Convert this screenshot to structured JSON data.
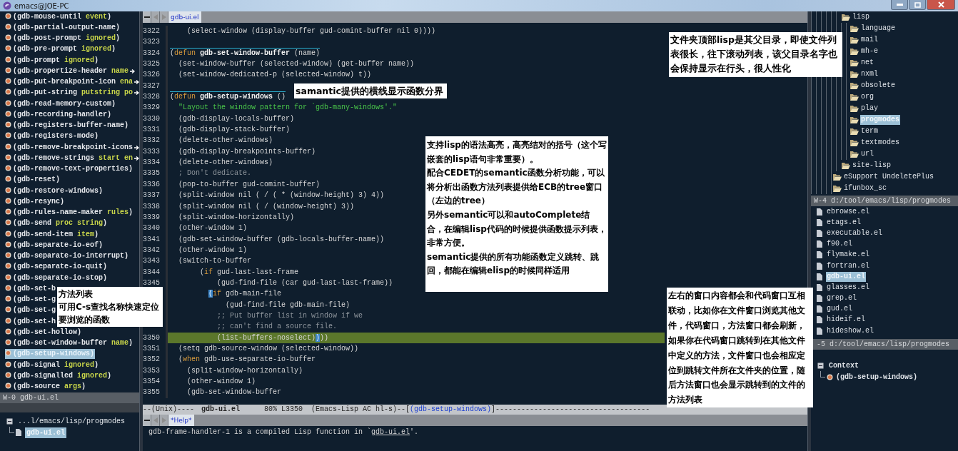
{
  "title_bar": {
    "title": "emacs@JOE-PC"
  },
  "method_list": {
    "items": [
      {
        "name": "(gdb-mouse-until",
        "args": "event",
        "tail": ")",
        "selected": false,
        "truncated": false
      },
      {
        "name": "(gdb-partial-output-name)",
        "selected": false,
        "truncated": false
      },
      {
        "name": "(gdb-post-prompt",
        "args": "ignored",
        "tail": ")",
        "selected": false,
        "truncated": false
      },
      {
        "name": "(gdb-pre-prompt",
        "args": "ignored",
        "tail": ")",
        "selected": false,
        "truncated": false
      },
      {
        "name": "(gdb-prompt",
        "args": "ignored",
        "tail": ")",
        "selected": false,
        "truncated": false
      },
      {
        "name": "(gdb-propertize-header",
        "args": "name",
        "selected": false,
        "truncated": true
      },
      {
        "name": "(gdb-put-breakpoint-icon",
        "args": "ena",
        "selected": false,
        "truncated": true
      },
      {
        "name": "(gdb-put-string",
        "args": "putstring po",
        "selected": false,
        "truncated": true
      },
      {
        "name": "(gdb-read-memory-custom)",
        "selected": false,
        "truncated": false
      },
      {
        "name": "(gdb-recording-handler)",
        "selected": false,
        "truncated": false
      },
      {
        "name": "(gdb-registers-buffer-name)",
        "selected": false,
        "truncated": false
      },
      {
        "name": "(gdb-registers-mode)",
        "selected": false,
        "truncated": false
      },
      {
        "name": "(gdb-remove-breakpoint-icons",
        "selected": false,
        "truncated": true
      },
      {
        "name": "(gdb-remove-strings",
        "args": "start en",
        "selected": false,
        "truncated": true
      },
      {
        "name": "(gdb-remove-text-properties)",
        "selected": false,
        "truncated": false
      },
      {
        "name": "(gdb-reset)",
        "selected": false,
        "truncated": false
      },
      {
        "name": "(gdb-restore-windows)",
        "selected": false,
        "truncated": false
      },
      {
        "name": "(gdb-resync)",
        "selected": false,
        "truncated": false
      },
      {
        "name": "(gdb-rules-name-maker",
        "args": "rules",
        "tail": ")",
        "selected": false,
        "truncated": false
      },
      {
        "name": "(gdb-send",
        "args": "proc string",
        "tail": ")",
        "selected": false,
        "truncated": false
      },
      {
        "name": "(gdb-send-item",
        "args": "item",
        "tail": ")",
        "selected": false,
        "truncated": false
      },
      {
        "name": "(gdb-separate-io-eof)",
        "selected": false,
        "truncated": false
      },
      {
        "name": "(gdb-separate-io-interrupt)",
        "selected": false,
        "truncated": false
      },
      {
        "name": "(gdb-separate-io-quit)",
        "selected": false,
        "truncated": false
      },
      {
        "name": "(gdb-separate-io-stop)",
        "selected": false,
        "truncated": false
      },
      {
        "name": "(gdb-set-b",
        "selected": false,
        "truncated": false
      },
      {
        "name": "(gdb-set-g",
        "selected": false,
        "truncated": false
      },
      {
        "name": "(gdb-set-g",
        "selected": false,
        "truncated": false
      },
      {
        "name": "(gdb-set-h",
        "selected": false,
        "truncated": false
      },
      {
        "name": "(gdb-set-hollow)",
        "selected": false,
        "truncated": false
      },
      {
        "name": "(gdb-set-window-buffer",
        "args": "name",
        "tail": ")",
        "selected": false,
        "truncated": false
      },
      {
        "name": "(gdb-setup-windows)",
        "selected": true,
        "truncated": false
      },
      {
        "name": "(gdb-signal",
        "args": "ignored",
        "tail": ")",
        "selected": false,
        "truncated": false
      },
      {
        "name": "(gdb-signalled",
        "args": "ignored",
        "tail": ")",
        "selected": false,
        "truncated": false
      },
      {
        "name": "(gdb-source",
        "args": "args",
        "tail": ")",
        "selected": false,
        "truncated": false
      }
    ],
    "mode_line": "W-0 gdb-ui.el"
  },
  "file_tree": {
    "label": "...l/emacs/lisp/progmodes",
    "expanded": true,
    "children": [
      {
        "label": "gdb-ui.el",
        "selected": true
      }
    ]
  },
  "editor": {
    "tab": {
      "label": "gdb-ui.el",
      "selected": true
    },
    "lines": [
      {
        "number": "3322",
        "current": false,
        "separator": false,
        "segments": [
          {
            "text": "    (select-window (display-buffer gud-comint-buffer nil 0))))",
            "kind": "plain"
          }
        ]
      },
      {
        "number": "3323",
        "current": false
      },
      {
        "number": "3324",
        "current": false,
        "separator": true,
        "segments": [
          {
            "text": "(",
            "kind": "plain"
          },
          {
            "text": "defun",
            "kind": "keyword"
          },
          {
            "text": " gdb-set-window-buffer",
            "kind": "name"
          },
          {
            "text": " (name)",
            "kind": "plain"
          }
        ]
      },
      {
        "number": "3325",
        "current": false,
        "separator": false,
        "segments": [
          {
            "text": "  (set-window-buffer (selected-window) (get-buffer name))",
            "kind": "plain"
          }
        ]
      },
      {
        "number": "3326",
        "current": false,
        "separator": false,
        "segments": [
          {
            "text": "  (set-window-dedicated-p (selected-window) t))",
            "kind": "plain"
          }
        ]
      },
      {
        "number": "3327",
        "current": false
      },
      {
        "number": "3328",
        "current": false,
        "separator": true,
        "segments": [
          {
            "text": "(",
            "kind": "plain"
          },
          {
            "text": "defun",
            "kind": "keyword"
          },
          {
            "text": " gdb-setup-windows",
            "kind": "name"
          },
          {
            "text": " ()",
            "kind": "plain"
          }
        ]
      },
      {
        "number": "3329",
        "current": false,
        "separator": false,
        "segments": [
          {
            "text": "  \"Layout the window pattern for `gdb-many-windows'.\"",
            "kind": "string"
          }
        ]
      },
      {
        "number": "3330",
        "current": false,
        "separator": false,
        "segments": [
          {
            "text": "  (gdb-display-locals-buffer)",
            "kind": "plain"
          }
        ]
      },
      {
        "number": "3331",
        "current": false,
        "separator": false,
        "segments": [
          {
            "text": "  (gdb-display-stack-buffer)",
            "kind": "plain"
          }
        ]
      },
      {
        "number": "3332",
        "current": false,
        "separator": false,
        "segments": [
          {
            "text": "  (delete-other-windows)",
            "kind": "plain"
          }
        ]
      },
      {
        "number": "3333",
        "current": false,
        "separator": false,
        "segments": [
          {
            "text": "  (gdb-display-breakpoints-buffer)",
            "kind": "plain"
          }
        ]
      },
      {
        "number": "3334",
        "current": false,
        "separator": false,
        "segments": [
          {
            "text": "  (delete-other-windows)",
            "kind": "plain"
          }
        ]
      },
      {
        "number": "3335",
        "current": false,
        "separator": false,
        "segments": [
          {
            "text": "  ; Don't dedicate.",
            "kind": "comment"
          }
        ]
      },
      {
        "number": "3336",
        "current": false,
        "separator": false,
        "segments": [
          {
            "text": "  (pop-to-buffer gud-comint-buffer)",
            "kind": "plain"
          }
        ]
      },
      {
        "number": "3337",
        "current": false,
        "separator": false,
        "segments": [
          {
            "text": "  (split-window nil ( / ( * (window-height) 3) 4))",
            "kind": "plain"
          }
        ]
      },
      {
        "number": "3338",
        "current": false,
        "separator": false,
        "segments": [
          {
            "text": "  (split-window nil ( / (window-height) 3))",
            "kind": "plain"
          }
        ]
      },
      {
        "number": "3339",
        "current": false,
        "separator": false,
        "segments": [
          {
            "text": "  (split-window-horizontally)",
            "kind": "plain"
          }
        ]
      },
      {
        "number": "3340",
        "current": false,
        "separator": false,
        "segments": [
          {
            "text": "  (other-window 1)",
            "kind": "plain"
          }
        ]
      },
      {
        "number": "3341",
        "current": false,
        "separator": false,
        "segments": [
          {
            "text": "  (gdb-set-window-buffer (gdb-locals-buffer-name))",
            "kind": "plain"
          }
        ]
      },
      {
        "number": "3342",
        "current": false,
        "separator": false,
        "segments": [
          {
            "text": "  (other-window 1)",
            "kind": "plain"
          }
        ]
      },
      {
        "number": "3343",
        "current": false,
        "separator": false,
        "segments": [
          {
            "text": "  (switch-to-buffer",
            "kind": "plain"
          }
        ]
      },
      {
        "number": "3344",
        "current": false,
        "separator": false,
        "segments": [
          {
            "text": "       (",
            "kind": "plain"
          },
          {
            "text": "if",
            "kind": "keyword"
          },
          {
            "text": " gud-last-last-frame",
            "kind": "plain"
          }
        ]
      },
      {
        "number": "3345",
        "current": false,
        "separator": false,
        "segments": [
          {
            "text": "           (gud-find-file (car gud-last-last-frame))",
            "kind": "plain"
          }
        ]
      },
      {
        "current": false,
        "separator": false,
        "segments": [
          {
            "text": "         (",
            "kind": "match"
          },
          {
            "text": "if",
            "kind": "keyword"
          },
          {
            "text": " gdb-main-file",
            "kind": "plain"
          }
        ]
      },
      {
        "current": false,
        "separator": false,
        "segments": [
          {
            "text": "             (gud-find-file gdb-main-file)",
            "kind": "plain"
          }
        ]
      },
      {
        "current": false,
        "separator": false,
        "segments": [
          {
            "text": "           ;; Put buffer list in window if we",
            "kind": "comment"
          }
        ]
      },
      {
        "current": false,
        "separator": false,
        "segments": [
          {
            "text": "           ;; can't find a source file.",
            "kind": "comment"
          }
        ]
      },
      {
        "number": "3350",
        "current": true,
        "separator": false,
        "segments": [
          {
            "text": "           (list-buffers-noselect)",
            "kind": "plain"
          },
          {
            "text": ")",
            "kind": "match"
          },
          {
            "text": "))",
            "kind": "plain"
          }
        ]
      },
      {
        "number": "3351",
        "current": false,
        "separator": false,
        "segments": [
          {
            "text": "  (setq gdb-source-window (selected-window))",
            "kind": "plain"
          }
        ]
      },
      {
        "number": "3352",
        "current": false,
        "separator": false,
        "segments": [
          {
            "text": "  (",
            "kind": "plain"
          },
          {
            "text": "when",
            "kind": "keyword"
          },
          {
            "text": " gdb-use-separate-io-buffer",
            "kind": "plain"
          }
        ]
      },
      {
        "number": "3353",
        "current": false,
        "separator": false,
        "segments": [
          {
            "text": "    (split-window-horizontally)",
            "kind": "plain"
          }
        ]
      },
      {
        "number": "3354",
        "current": false,
        "separator": false,
        "segments": [
          {
            "text": "    (other-window 1)",
            "kind": "plain"
          }
        ]
      },
      {
        "number": "3355",
        "current": false,
        "separator": false,
        "segments": [
          {
            "text": "    (gdb-set-window-buffer",
            "kind": "plain"
          }
        ]
      }
    ],
    "mode_line": [
      {
        "text": "--(Unix)----",
        "kind": "plain"
      },
      {
        "text": "gdb-ui.el",
        "kind": "buffer"
      },
      {
        "text": "80% L3350",
        "kind": "plain"
      },
      {
        "text": "(Emacs-Lisp AC hl-s)--[",
        "kind": "plain"
      },
      {
        "text": "(gdb-setup-windows)",
        "kind": "function"
      },
      {
        "text": "]------------------------------------",
        "kind": "plain"
      }
    ]
  },
  "help": {
    "tab": {
      "label": "*Help*",
      "selected": true
    },
    "text_before": "gdb-frame-handler-1 is a compiled Lisp function in `",
    "link": "gdb-ui.el",
    "text_after": "'."
  },
  "dir_tree": [
    {
      "children": [
        {
          "label": "lisp",
          "selected": false,
          "children": [
            {
              "label": "language",
              "selected": false
            },
            {
              "label": "mail",
              "selected": false
            },
            {
              "label": "mh-e",
              "selected": false
            },
            {
              "label": "net",
              "selected": false
            },
            {
              "label": "nxml",
              "selected": false
            },
            {
              "label": "obsolete",
              "selected": false
            },
            {
              "label": "org",
              "selected": false
            },
            {
              "label": "play",
              "selected": false
            },
            {
              "label": "progmodes",
              "selected": true
            },
            {
              "label": "term",
              "selected": false
            },
            {
              "label": "textmodes",
              "selected": false
            },
            {
              "label": "url",
              "selected": false
            }
          ]
        },
        {
          "label": "site-lisp",
          "selected": false
        }
      ]
    },
    {
      "label": "eSupport UndeletePlus",
      "selected": false
    },
    {
      "label": "ifunbox_sc",
      "selected": false
    }
  ],
  "file_list": {
    "mode_line": "W-4 d:/tool/emacs/lisp/progmodes",
    "items": [
      {
        "label": "ebrowse.el",
        "selected": false
      },
      {
        "label": "etags.el",
        "selected": false
      },
      {
        "label": "executable.el",
        "selected": false
      },
      {
        "label": "f90.el",
        "selected": false
      },
      {
        "label": "flymake.el",
        "selected": false
      },
      {
        "label": "fortran.el",
        "selected": false
      },
      {
        "label": "gdb-ui.el",
        "selected": true
      },
      {
        "label": "glasses.el",
        "selected": false
      },
      {
        "label": "grep.el",
        "selected": false
      },
      {
        "label": "gud.el",
        "selected": false
      },
      {
        "label": "hideif.el",
        "selected": false
      },
      {
        "label": "hideshow.el",
        "selected": false
      }
    ]
  },
  "context": {
    "mode_line": "-5 d:/tool/emacs/lisp/progmodes",
    "label": "Context",
    "expanded": true,
    "children": [
      {
        "label": "(gdb-setup-windows)"
      }
    ]
  },
  "annotations": [
    {
      "paragraphs": [
        "方法列表",
        "可用C-s查找名称快速定位",
        "要浏览的函数"
      ]
    },
    {
      "paragraphs": [
        "samantic提供的横线显示函数分界"
      ]
    },
    {
      "paragraphs": [
        "支持lisp的语法高亮，高亮结对的括号（这个写嵌套的lisp语句非常重要）。",
        "配合CEDET的semantic函数分析功能，可以将分析出函数方法列表提供给ECB的tree窗口（左边的tree）",
        "另外semantic可以和autoComplete结合，在编辑lisp代码的时候提供函数提示列表，非常方便。",
        "semantic提供的所有功能函数定义跳转、跳回，都能在编辑elisp的时候同样适用"
      ]
    },
    {
      "paragraphs": [
        "文件夹顶部lisp是其父目录，即使文件列表很长，往下滚动列表，该父目录名字也会保持显示在行头，很人性化"
      ]
    },
    {
      "paragraphs": [
        "左右的窗口内容都会和代码窗口互相联动，比如你在文件窗口浏览其他文件，代码窗口，方法窗口都会刷新，如果你在代码窗口跳转到在其他文件中定义的方法，文件窗口也会相应定位到跳转文件所在文件夹的位置，随后方法窗口也会显示跳转到的文件的方法列表"
      ]
    }
  ]
}
